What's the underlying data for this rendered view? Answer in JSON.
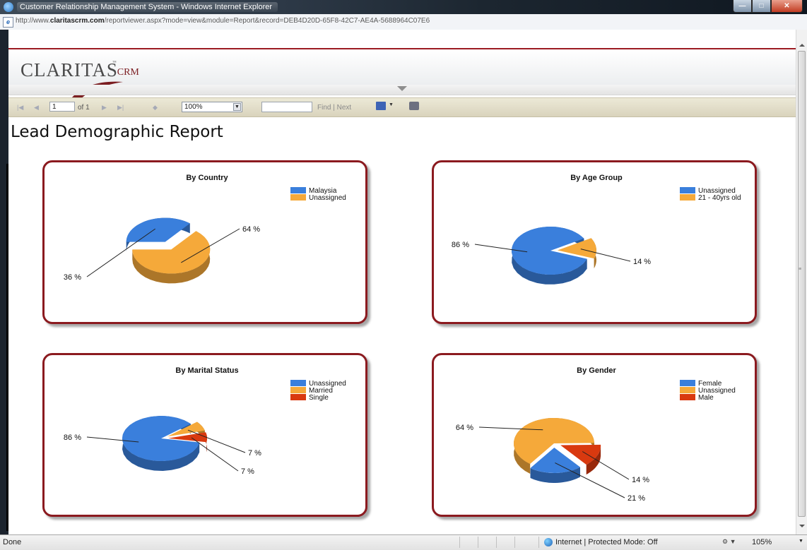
{
  "window": {
    "title": "Customer Relationship Management System - Windows Internet Explorer",
    "url_prefix": "http://www.",
    "url_domain": "claritascrm.com",
    "url_path": "/reportviewer.aspx?mode=view&module=Report&record=DEB4D20D-65F8-42C7-AE4A-5688964C07E6"
  },
  "logo": {
    "text": "CLARITAS",
    "suffix": "CRM",
    "tm": "™"
  },
  "toolbar": {
    "page_value": "1",
    "of_label": "of 1",
    "zoom_value": "100%",
    "find_label": "Find",
    "find_sep": "|",
    "next_label": "Next"
  },
  "report": {
    "title": "Lead Demographic Report"
  },
  "colors": {
    "blue": "#3a7fdc",
    "orange": "#f5a93a",
    "red": "#d9390f",
    "frame": "#8b1a1f"
  },
  "chart_data": [
    {
      "type": "pie",
      "title": "By Country",
      "slices": [
        {
          "name": "Malaysia",
          "value": 36,
          "label": "36 %",
          "color": "#3a7fdc"
        },
        {
          "name": "Unassigned",
          "value": 64,
          "label": "64 %",
          "color": "#f5a93a"
        }
      ]
    },
    {
      "type": "pie",
      "title": "By Age Group",
      "slices": [
        {
          "name": "Unassigned",
          "value": 86,
          "label": "86 %",
          "color": "#3a7fdc"
        },
        {
          "name": "21 - 40yrs old",
          "value": 14,
          "label": "14 %",
          "color": "#f5a93a"
        }
      ]
    },
    {
      "type": "pie",
      "title": "By Marital Status",
      "slices": [
        {
          "name": "Unassigned",
          "value": 86,
          "label": "86 %",
          "color": "#3a7fdc"
        },
        {
          "name": "Married",
          "value": 7,
          "label": "7 %",
          "color": "#f5a93a"
        },
        {
          "name": "Single",
          "value": 7,
          "label": "7 %",
          "color": "#d9390f"
        }
      ]
    },
    {
      "type": "pie",
      "title": "By Gender",
      "slices": [
        {
          "name": "Female",
          "value": 21,
          "label": "21 %",
          "color": "#3a7fdc"
        },
        {
          "name": "Unassigned",
          "value": 64,
          "label": "64 %",
          "color": "#f5a93a"
        },
        {
          "name": "Male",
          "value": 14,
          "label": "14 %",
          "color": "#d9390f"
        }
      ]
    }
  ],
  "status": {
    "left": "Done",
    "zone": "Internet | Protected Mode: Off",
    "zoom": "105%"
  }
}
